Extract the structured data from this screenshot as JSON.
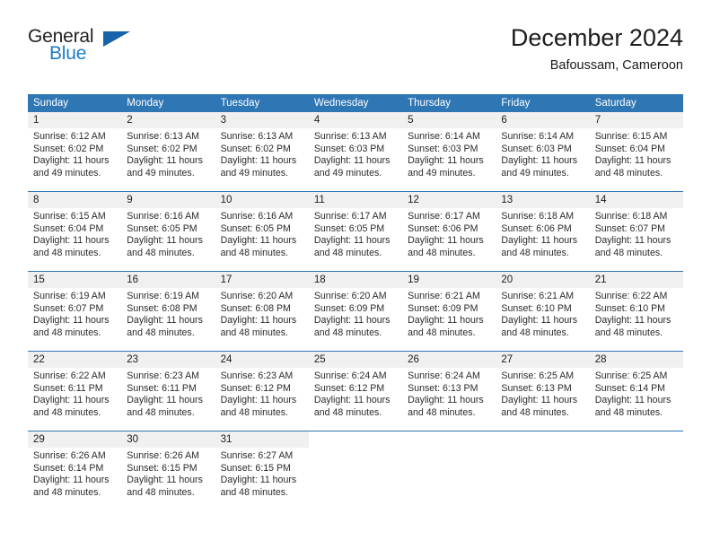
{
  "brand": {
    "word_one": "General",
    "word_two": "Blue",
    "flag_icon": "triangle-flag-icon"
  },
  "header": {
    "title": "December 2024",
    "subtitle": "Bafoussam, Cameroon"
  },
  "colors": {
    "header_blue": "#2f76b5",
    "day_band_gray": "#f0f0f0",
    "brand_blue": "#1e7bc4",
    "text_dark": "#1c1c1c"
  },
  "weekdays": [
    "Sunday",
    "Monday",
    "Tuesday",
    "Wednesday",
    "Thursday",
    "Friday",
    "Saturday"
  ],
  "weeks": [
    [
      {
        "day": "1",
        "sunrise": "Sunrise: 6:12 AM",
        "sunset": "Sunset: 6:02 PM",
        "daylight1": "Daylight: 11 hours",
        "daylight2": "and 49 minutes."
      },
      {
        "day": "2",
        "sunrise": "Sunrise: 6:13 AM",
        "sunset": "Sunset: 6:02 PM",
        "daylight1": "Daylight: 11 hours",
        "daylight2": "and 49 minutes."
      },
      {
        "day": "3",
        "sunrise": "Sunrise: 6:13 AM",
        "sunset": "Sunset: 6:02 PM",
        "daylight1": "Daylight: 11 hours",
        "daylight2": "and 49 minutes."
      },
      {
        "day": "4",
        "sunrise": "Sunrise: 6:13 AM",
        "sunset": "Sunset: 6:03 PM",
        "daylight1": "Daylight: 11 hours",
        "daylight2": "and 49 minutes."
      },
      {
        "day": "5",
        "sunrise": "Sunrise: 6:14 AM",
        "sunset": "Sunset: 6:03 PM",
        "daylight1": "Daylight: 11 hours",
        "daylight2": "and 49 minutes."
      },
      {
        "day": "6",
        "sunrise": "Sunrise: 6:14 AM",
        "sunset": "Sunset: 6:03 PM",
        "daylight1": "Daylight: 11 hours",
        "daylight2": "and 49 minutes."
      },
      {
        "day": "7",
        "sunrise": "Sunrise: 6:15 AM",
        "sunset": "Sunset: 6:04 PM",
        "daylight1": "Daylight: 11 hours",
        "daylight2": "and 48 minutes."
      }
    ],
    [
      {
        "day": "8",
        "sunrise": "Sunrise: 6:15 AM",
        "sunset": "Sunset: 6:04 PM",
        "daylight1": "Daylight: 11 hours",
        "daylight2": "and 48 minutes."
      },
      {
        "day": "9",
        "sunrise": "Sunrise: 6:16 AM",
        "sunset": "Sunset: 6:05 PM",
        "daylight1": "Daylight: 11 hours",
        "daylight2": "and 48 minutes."
      },
      {
        "day": "10",
        "sunrise": "Sunrise: 6:16 AM",
        "sunset": "Sunset: 6:05 PM",
        "daylight1": "Daylight: 11 hours",
        "daylight2": "and 48 minutes."
      },
      {
        "day": "11",
        "sunrise": "Sunrise: 6:17 AM",
        "sunset": "Sunset: 6:05 PM",
        "daylight1": "Daylight: 11 hours",
        "daylight2": "and 48 minutes."
      },
      {
        "day": "12",
        "sunrise": "Sunrise: 6:17 AM",
        "sunset": "Sunset: 6:06 PM",
        "daylight1": "Daylight: 11 hours",
        "daylight2": "and 48 minutes."
      },
      {
        "day": "13",
        "sunrise": "Sunrise: 6:18 AM",
        "sunset": "Sunset: 6:06 PM",
        "daylight1": "Daylight: 11 hours",
        "daylight2": "and 48 minutes."
      },
      {
        "day": "14",
        "sunrise": "Sunrise: 6:18 AM",
        "sunset": "Sunset: 6:07 PM",
        "daylight1": "Daylight: 11 hours",
        "daylight2": "and 48 minutes."
      }
    ],
    [
      {
        "day": "15",
        "sunrise": "Sunrise: 6:19 AM",
        "sunset": "Sunset: 6:07 PM",
        "daylight1": "Daylight: 11 hours",
        "daylight2": "and 48 minutes."
      },
      {
        "day": "16",
        "sunrise": "Sunrise: 6:19 AM",
        "sunset": "Sunset: 6:08 PM",
        "daylight1": "Daylight: 11 hours",
        "daylight2": "and 48 minutes."
      },
      {
        "day": "17",
        "sunrise": "Sunrise: 6:20 AM",
        "sunset": "Sunset: 6:08 PM",
        "daylight1": "Daylight: 11 hours",
        "daylight2": "and 48 minutes."
      },
      {
        "day": "18",
        "sunrise": "Sunrise: 6:20 AM",
        "sunset": "Sunset: 6:09 PM",
        "daylight1": "Daylight: 11 hours",
        "daylight2": "and 48 minutes."
      },
      {
        "day": "19",
        "sunrise": "Sunrise: 6:21 AM",
        "sunset": "Sunset: 6:09 PM",
        "daylight1": "Daylight: 11 hours",
        "daylight2": "and 48 minutes."
      },
      {
        "day": "20",
        "sunrise": "Sunrise: 6:21 AM",
        "sunset": "Sunset: 6:10 PM",
        "daylight1": "Daylight: 11 hours",
        "daylight2": "and 48 minutes."
      },
      {
        "day": "21",
        "sunrise": "Sunrise: 6:22 AM",
        "sunset": "Sunset: 6:10 PM",
        "daylight1": "Daylight: 11 hours",
        "daylight2": "and 48 minutes."
      }
    ],
    [
      {
        "day": "22",
        "sunrise": "Sunrise: 6:22 AM",
        "sunset": "Sunset: 6:11 PM",
        "daylight1": "Daylight: 11 hours",
        "daylight2": "and 48 minutes."
      },
      {
        "day": "23",
        "sunrise": "Sunrise: 6:23 AM",
        "sunset": "Sunset: 6:11 PM",
        "daylight1": "Daylight: 11 hours",
        "daylight2": "and 48 minutes."
      },
      {
        "day": "24",
        "sunrise": "Sunrise: 6:23 AM",
        "sunset": "Sunset: 6:12 PM",
        "daylight1": "Daylight: 11 hours",
        "daylight2": "and 48 minutes."
      },
      {
        "day": "25",
        "sunrise": "Sunrise: 6:24 AM",
        "sunset": "Sunset: 6:12 PM",
        "daylight1": "Daylight: 11 hours",
        "daylight2": "and 48 minutes."
      },
      {
        "day": "26",
        "sunrise": "Sunrise: 6:24 AM",
        "sunset": "Sunset: 6:13 PM",
        "daylight1": "Daylight: 11 hours",
        "daylight2": "and 48 minutes."
      },
      {
        "day": "27",
        "sunrise": "Sunrise: 6:25 AM",
        "sunset": "Sunset: 6:13 PM",
        "daylight1": "Daylight: 11 hours",
        "daylight2": "and 48 minutes."
      },
      {
        "day": "28",
        "sunrise": "Sunrise: 6:25 AM",
        "sunset": "Sunset: 6:14 PM",
        "daylight1": "Daylight: 11 hours",
        "daylight2": "and 48 minutes."
      }
    ],
    [
      {
        "day": "29",
        "sunrise": "Sunrise: 6:26 AM",
        "sunset": "Sunset: 6:14 PM",
        "daylight1": "Daylight: 11 hours",
        "daylight2": "and 48 minutes."
      },
      {
        "day": "30",
        "sunrise": "Sunrise: 6:26 AM",
        "sunset": "Sunset: 6:15 PM",
        "daylight1": "Daylight: 11 hours",
        "daylight2": "and 48 minutes."
      },
      {
        "day": "31",
        "sunrise": "Sunrise: 6:27 AM",
        "sunset": "Sunset: 6:15 PM",
        "daylight1": "Daylight: 11 hours",
        "daylight2": "and 48 minutes."
      },
      {
        "day": "",
        "sunrise": "",
        "sunset": "",
        "daylight1": "",
        "daylight2": ""
      },
      {
        "day": "",
        "sunrise": "",
        "sunset": "",
        "daylight1": "",
        "daylight2": ""
      },
      {
        "day": "",
        "sunrise": "",
        "sunset": "",
        "daylight1": "",
        "daylight2": ""
      },
      {
        "day": "",
        "sunrise": "",
        "sunset": "",
        "daylight1": "",
        "daylight2": ""
      }
    ]
  ]
}
